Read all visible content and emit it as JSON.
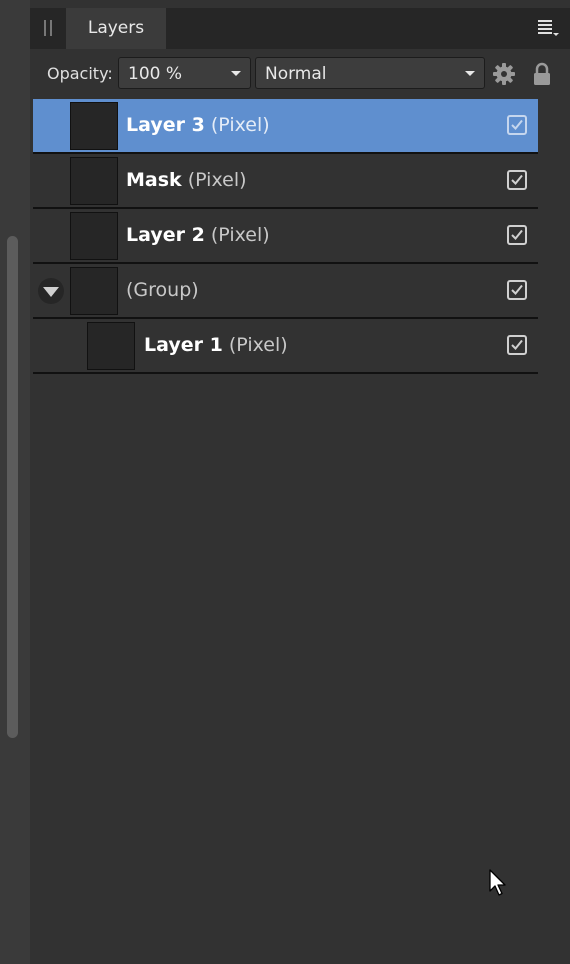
{
  "panel": {
    "tab_label": "Layers"
  },
  "toolbar": {
    "opacity_label": "Opacity:",
    "opacity_value": "100 %",
    "blend_mode": "Normal"
  },
  "icons": {
    "grip": "grip-icon",
    "panel_menu": "panel-menu-icon",
    "settings": "gear-icon",
    "lock": "lock-icon",
    "expander": "disclosure-triangle-icon",
    "cursor": "mouse-pointer-icon"
  },
  "colors": {
    "selection": "#5f8fcf",
    "panel_bg": "#323232",
    "tabbar_bg": "#262626"
  },
  "layers": [
    {
      "name": "Layer 3",
      "type": "(Pixel)",
      "visible": true,
      "selected": true
    },
    {
      "name": "Mask",
      "type": "(Pixel)",
      "visible": true,
      "selected": false
    },
    {
      "name": "Layer 2",
      "type": "(Pixel)",
      "visible": true,
      "selected": false
    },
    {
      "name": "",
      "type": "(Group)",
      "visible": true,
      "selected": false,
      "expanded": true
    },
    {
      "name": "Layer 1",
      "type": "(Pixel)",
      "visible": true,
      "selected": false
    }
  ]
}
